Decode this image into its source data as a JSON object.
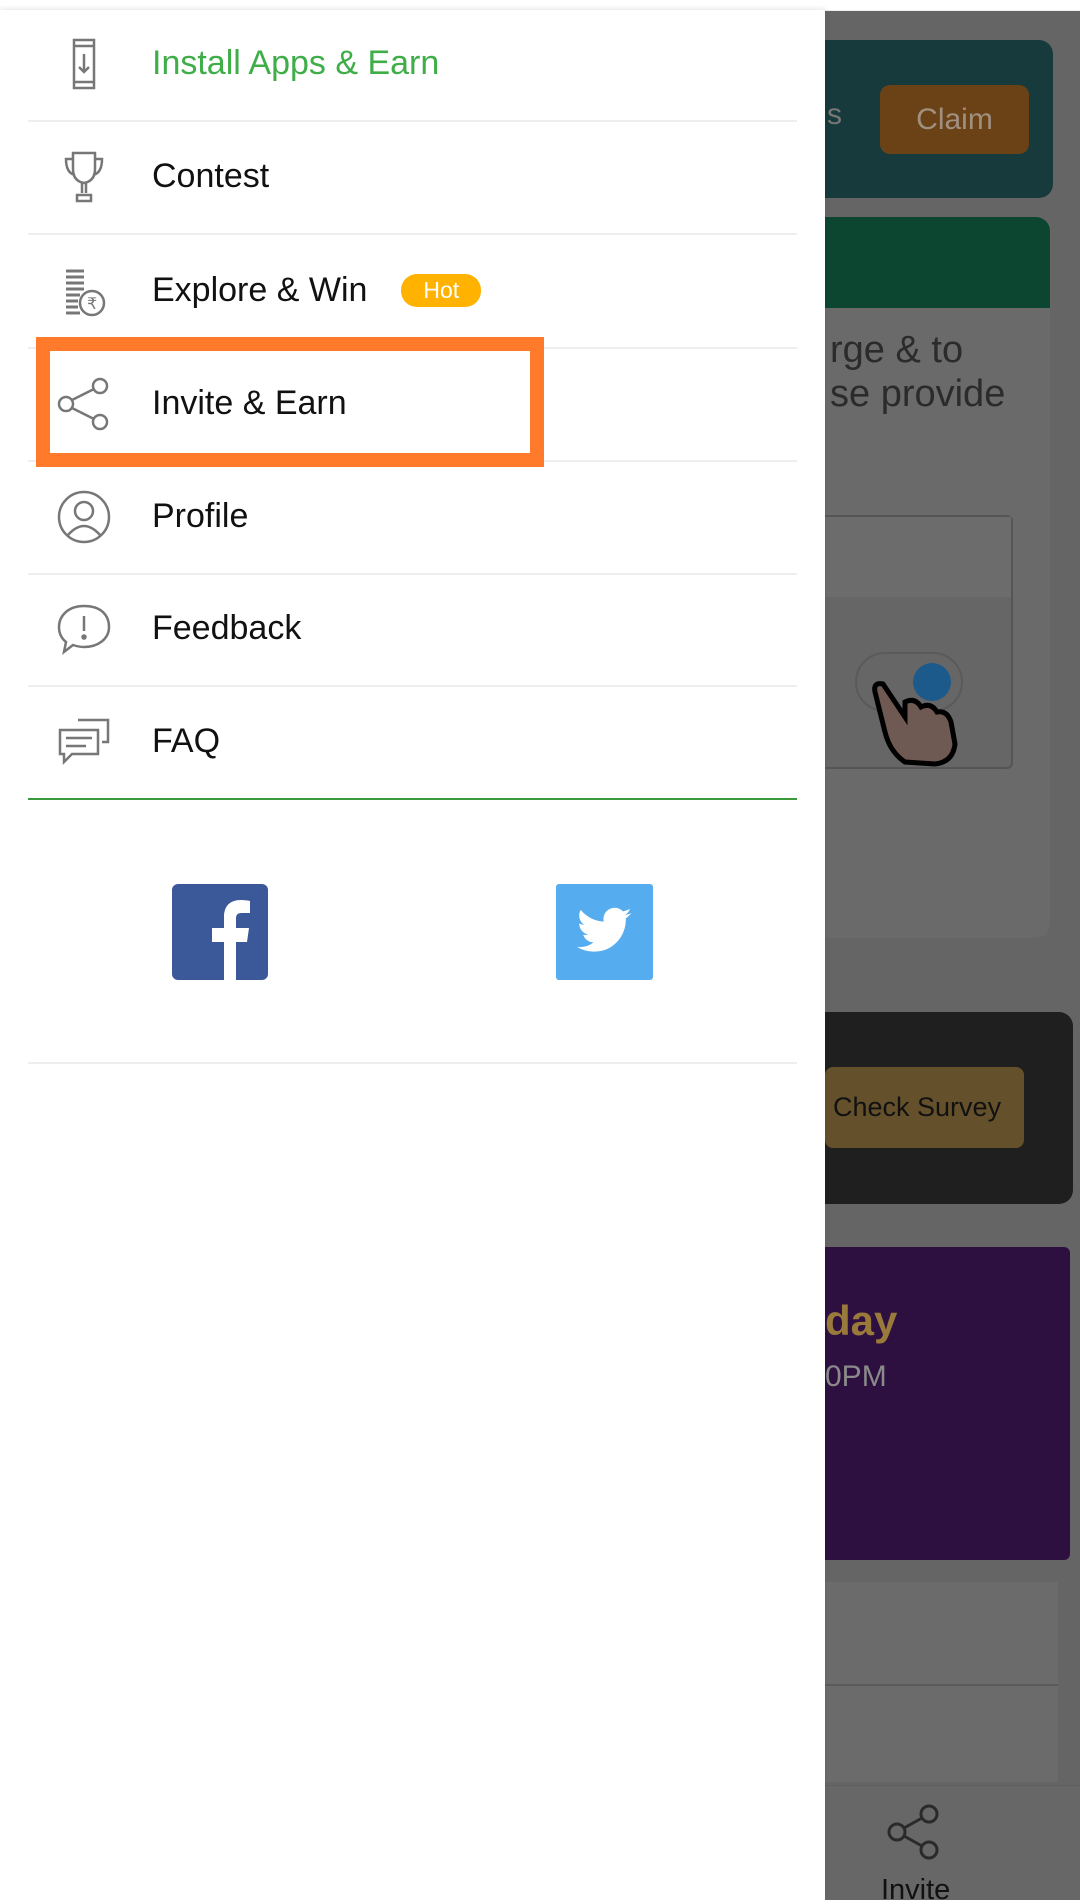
{
  "drawer": {
    "items": [
      {
        "label": "Install Apps & Earn",
        "icon": "install-app-icon",
        "active": true
      },
      {
        "label": "Contest",
        "icon": "trophy-icon"
      },
      {
        "label": "Explore & Win",
        "icon": "coins-rupee-icon",
        "badge": "Hot"
      },
      {
        "label": "Invite & Earn",
        "icon": "share-icon",
        "highlighted": true
      },
      {
        "label": "Profile",
        "icon": "user-circle-icon"
      },
      {
        "label": "Feedback",
        "icon": "feedback-icon"
      },
      {
        "label": "FAQ",
        "icon": "chat-icon"
      }
    ],
    "social": [
      "facebook-icon",
      "twitter-icon"
    ]
  },
  "background": {
    "claim_button": "Claim",
    "card_text_1": "rge & to",
    "card_text_2": "se provide",
    "partial_s": "s",
    "check_survey_button": "Check Survey",
    "promo_title": "day",
    "promo_time": "0PM",
    "bottom_nav_invite": "Invite"
  },
  "colors": {
    "accent_green": "#3fae49",
    "highlight": "#ff7a2a",
    "hot_badge": "#ffb300",
    "facebook": "#3b5998",
    "twitter": "#55acee"
  }
}
